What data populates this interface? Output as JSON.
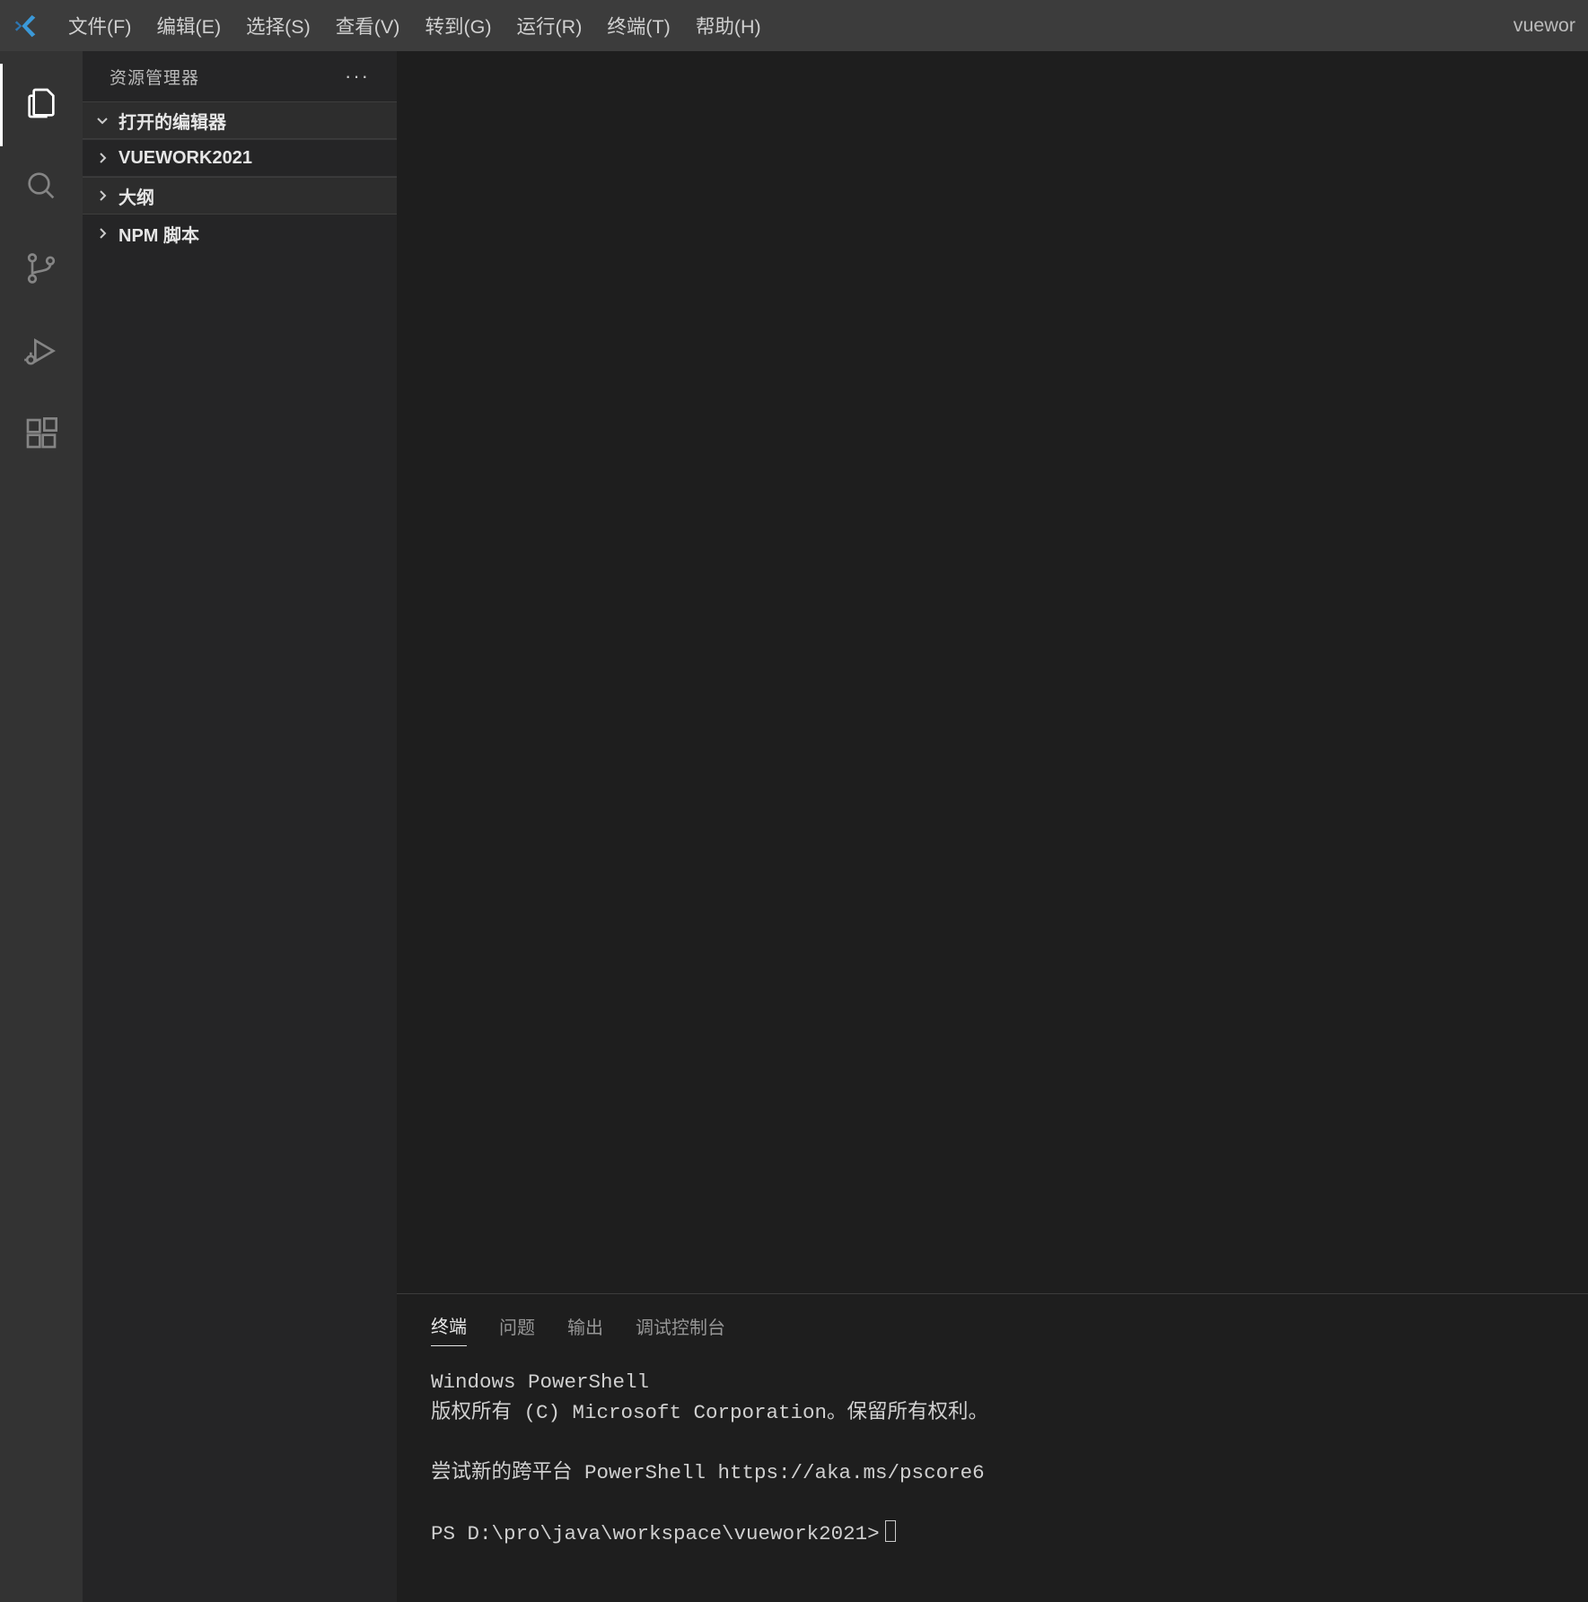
{
  "titlebar": {
    "menus": [
      "文件(F)",
      "编辑(E)",
      "选择(S)",
      "查看(V)",
      "转到(G)",
      "运行(R)",
      "终端(T)",
      "帮助(H)"
    ],
    "title": "vuewor"
  },
  "activity": {
    "items": [
      "explorer",
      "search",
      "source-control",
      "run-debug",
      "extensions"
    ],
    "active": "explorer"
  },
  "sidebar": {
    "header": "资源管理器",
    "more_glyph": "···",
    "sections": [
      {
        "label": "打开的编辑器",
        "expanded": true
      },
      {
        "label": "VUEWORK2021",
        "expanded": false
      },
      {
        "label": "大纲",
        "expanded": false
      },
      {
        "label": "NPM 脚本",
        "expanded": false
      }
    ]
  },
  "panel": {
    "tabs": [
      "终端",
      "问题",
      "输出",
      "调试控制台"
    ],
    "active": "终端",
    "terminal": {
      "line1": "Windows PowerShell",
      "line2": "版权所有 (C) Microsoft Corporation。保留所有权利。",
      "blank": "",
      "line3": "尝试新的跨平台 PowerShell https://aka.ms/pscore6",
      "prompt": "PS D:\\pro\\java\\workspace\\vuework2021>"
    }
  }
}
